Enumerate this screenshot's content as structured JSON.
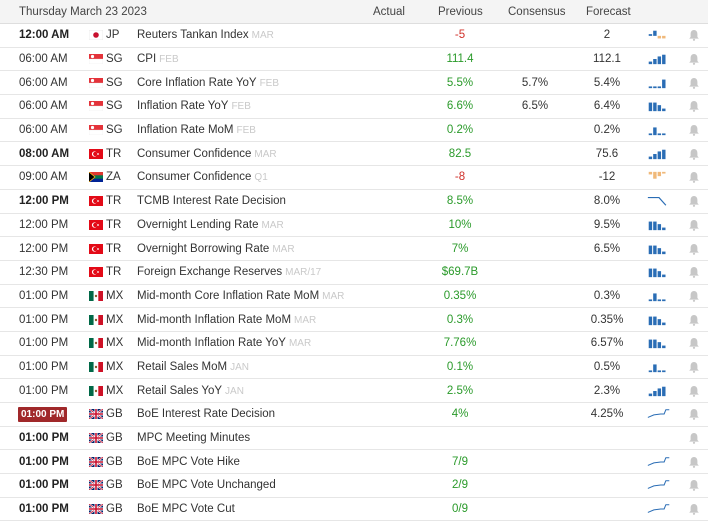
{
  "header": {
    "date": "Thursday March 23 2023",
    "col_actual": "Actual",
    "col_previous": "Previous",
    "col_consensus": "Consensus",
    "col_forecast": "Forecast"
  },
  "rows": [
    {
      "time": "12:00 AM",
      "bold": true,
      "country": "JP",
      "event": "Reuters Tankan Index",
      "period": "MAR",
      "previous": "-5",
      "prev_sign": "neg",
      "consensus": "",
      "forecast": "2",
      "chart": "bars-neg"
    },
    {
      "time": "06:00 AM",
      "bold": false,
      "country": "SG",
      "event": "CPI",
      "period": "FEB",
      "previous": "111.4",
      "prev_sign": "pos",
      "consensus": "",
      "forecast": "112.1",
      "chart": "bars-up"
    },
    {
      "time": "06:00 AM",
      "bold": false,
      "country": "SG",
      "event": "Core Inflation Rate YoY",
      "period": "FEB",
      "previous": "5.5%",
      "prev_sign": "pos",
      "consensus": "5.7%",
      "forecast": "5.4%",
      "chart": "bars-flat"
    },
    {
      "time": "06:00 AM",
      "bold": false,
      "country": "SG",
      "event": "Inflation Rate YoY",
      "period": "FEB",
      "previous": "6.6%",
      "prev_sign": "pos",
      "consensus": "6.5%",
      "forecast": "6.4%",
      "chart": "bars-hi"
    },
    {
      "time": "06:00 AM",
      "bold": false,
      "country": "SG",
      "event": "Inflation Rate MoM",
      "period": "FEB",
      "previous": "0.2%",
      "prev_sign": "pos",
      "consensus": "",
      "forecast": "0.2%",
      "chart": "bars-mix"
    },
    {
      "time": "08:00 AM",
      "bold": true,
      "country": "TR",
      "event": "Consumer Confidence",
      "period": "MAR",
      "previous": "82.5",
      "prev_sign": "pos",
      "consensus": "",
      "forecast": "75.6",
      "chart": "bars-up"
    },
    {
      "time": "09:00 AM",
      "bold": false,
      "country": "ZA",
      "event": "Consumer Confidence",
      "period": "Q1",
      "previous": "-8",
      "prev_sign": "neg",
      "consensus": "",
      "forecast": "-12",
      "chart": "bars-negdown"
    },
    {
      "time": "12:00 PM",
      "bold": true,
      "country": "TR",
      "event": "TCMB Interest Rate Decision",
      "period": "",
      "previous": "8.5%",
      "prev_sign": "pos",
      "consensus": "",
      "forecast": "8.0%",
      "chart": "line-down"
    },
    {
      "time": "12:00 PM",
      "bold": false,
      "country": "TR",
      "event": "Overnight Lending Rate",
      "period": "MAR",
      "previous": "10%",
      "prev_sign": "pos",
      "consensus": "",
      "forecast": "9.5%",
      "chart": "bars-hi"
    },
    {
      "time": "12:00 PM",
      "bold": false,
      "country": "TR",
      "event": "Overnight Borrowing Rate",
      "period": "MAR",
      "previous": "7%",
      "prev_sign": "pos",
      "consensus": "",
      "forecast": "6.5%",
      "chart": "bars-hi"
    },
    {
      "time": "12:30 PM",
      "bold": false,
      "country": "TR",
      "event": "Foreign Exchange Reserves",
      "period": "MAR/17",
      "previous": "$69.7B",
      "prev_sign": "pos",
      "consensus": "",
      "forecast": "",
      "chart": "bars-hi"
    },
    {
      "time": "01:00 PM",
      "bold": false,
      "country": "MX",
      "event": "Mid-month Core Inflation Rate MoM",
      "period": "MAR",
      "previous": "0.35%",
      "prev_sign": "pos",
      "consensus": "",
      "forecast": "0.3%",
      "chart": "bars-mix"
    },
    {
      "time": "01:00 PM",
      "bold": false,
      "country": "MX",
      "event": "Mid-month Inflation Rate MoM",
      "period": "MAR",
      "previous": "0.3%",
      "prev_sign": "pos",
      "consensus": "",
      "forecast": "0.35%",
      "chart": "bars-hi"
    },
    {
      "time": "01:00 PM",
      "bold": false,
      "country": "MX",
      "event": "Mid-month Inflation Rate YoY",
      "period": "MAR",
      "previous": "7.76%",
      "prev_sign": "pos",
      "consensus": "",
      "forecast": "6.57%",
      "chart": "bars-hi"
    },
    {
      "time": "01:00 PM",
      "bold": false,
      "country": "MX",
      "event": "Retail Sales MoM",
      "period": "JAN",
      "previous": "0.1%",
      "prev_sign": "pos",
      "consensus": "",
      "forecast": "0.5%",
      "chart": "bars-mix"
    },
    {
      "time": "01:00 PM",
      "bold": false,
      "country": "MX",
      "event": "Retail Sales YoY",
      "period": "JAN",
      "previous": "2.5%",
      "prev_sign": "pos",
      "consensus": "",
      "forecast": "2.3%",
      "chart": "bars-up"
    },
    {
      "time": "01:00 PM",
      "bold": true,
      "live": true,
      "country": "GB",
      "event": "BoE Interest Rate Decision",
      "period": "",
      "previous": "4%",
      "prev_sign": "pos",
      "consensus": "",
      "forecast": "4.25%",
      "chart": "line-up"
    },
    {
      "time": "01:00 PM",
      "bold": true,
      "country": "GB",
      "event": "MPC Meeting Minutes",
      "period": "",
      "previous": "",
      "prev_sign": "pos",
      "consensus": "",
      "forecast": "",
      "chart": "none"
    },
    {
      "time": "01:00 PM",
      "bold": true,
      "country": "GB",
      "event": "BoE MPC Vote Hike",
      "period": "",
      "previous": "7/9",
      "prev_sign": "pos",
      "consensus": "",
      "forecast": "",
      "chart": "line-up"
    },
    {
      "time": "01:00 PM",
      "bold": true,
      "country": "GB",
      "event": "BoE MPC Vote Unchanged",
      "period": "",
      "previous": "2/9",
      "prev_sign": "pos",
      "consensus": "",
      "forecast": "",
      "chart": "line-up"
    },
    {
      "time": "01:00 PM",
      "bold": true,
      "country": "GB",
      "event": "BoE MPC Vote Cut",
      "period": "",
      "previous": "0/9",
      "prev_sign": "pos",
      "consensus": "",
      "forecast": "",
      "chart": "line-up"
    }
  ],
  "colors": {
    "positive": "#2a9a2a",
    "negative": "#d0302a",
    "bar": "#2a6db5",
    "bar_neg": "#f0b97a",
    "live_badge": "#a0282a"
  },
  "icons": {
    "alert": "bell-icon"
  }
}
